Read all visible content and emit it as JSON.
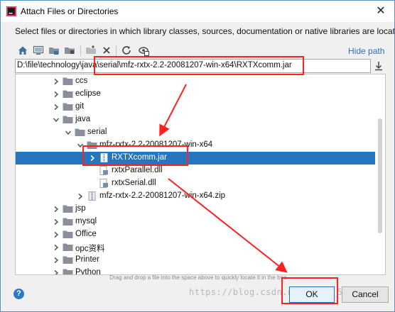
{
  "dialog": {
    "title": "Attach Files or Directories",
    "subtitle": "Select files or directories in which library classes, sources, documentation or native libraries are located",
    "hide_path_label": "Hide path",
    "path_value": "D:\\file\\technology\\java\\serial\\mfz-rxtx-2.2-20081207-win-x64\\RXTXcomm.jar",
    "drag_hint": "Drag and drop a file into the space above to quickly locate it in the tree",
    "ok_label": "OK",
    "cancel_label": "Cancel",
    "help_label": "?",
    "close_label": "✕"
  },
  "toolbar_icons": [
    "home-icon",
    "desktop-icon",
    "project-folder-icon",
    "module-folder-icon",
    "new-folder-icon",
    "delete-icon",
    "refresh-icon",
    "show-hidden-icon"
  ],
  "tree": [
    {
      "label": "ccs",
      "type": "folder",
      "level": 0,
      "expanded": false,
      "selected": false
    },
    {
      "label": "eclipse",
      "type": "folder",
      "level": 0,
      "expanded": false,
      "selected": false
    },
    {
      "label": "git",
      "type": "folder",
      "level": 0,
      "expanded": false,
      "selected": false
    },
    {
      "label": "java",
      "type": "folder",
      "level": 0,
      "expanded": true,
      "selected": false
    },
    {
      "label": "serial",
      "type": "folder",
      "level": 1,
      "expanded": true,
      "selected": false
    },
    {
      "label": "mfz-rxtx-2.2-20081207-win-x64",
      "type": "folder",
      "level": 2,
      "expanded": true,
      "selected": false
    },
    {
      "label": "RXTXcomm.jar",
      "type": "jar",
      "level": 3,
      "expanded": false,
      "selected": true
    },
    {
      "label": "rxtxParallel.dll",
      "type": "dll",
      "level": 3,
      "expanded": null,
      "selected": false
    },
    {
      "label": "rxtxSerial.dll",
      "type": "dll",
      "level": 3,
      "expanded": null,
      "selected": false
    },
    {
      "label": "mfz-rxtx-2.2-20081207-win-x64.zip",
      "type": "zip",
      "level": 2,
      "expanded": false,
      "selected": false
    },
    {
      "label": "jsp",
      "type": "folder",
      "level": 0,
      "expanded": false,
      "selected": false
    },
    {
      "label": "mysql",
      "type": "folder",
      "level": 0,
      "expanded": false,
      "selected": false
    },
    {
      "label": "Office",
      "type": "folder",
      "level": 0,
      "expanded": false,
      "selected": false
    },
    {
      "label": "opc资料",
      "type": "folder",
      "level": 0,
      "expanded": false,
      "selected": false
    },
    {
      "label": "Printer",
      "type": "folder",
      "level": 0,
      "expanded": false,
      "selected": false
    },
    {
      "label": "Python",
      "type": "folder",
      "level": 0,
      "expanded": false,
      "selected": false
    }
  ],
  "watermark": "https://blog.csdn.net/l0iz_50",
  "colors": {
    "selection": "#2675bf",
    "folder": "#8a9099",
    "link": "#2f6fc0",
    "annotation": "#ff2020"
  }
}
